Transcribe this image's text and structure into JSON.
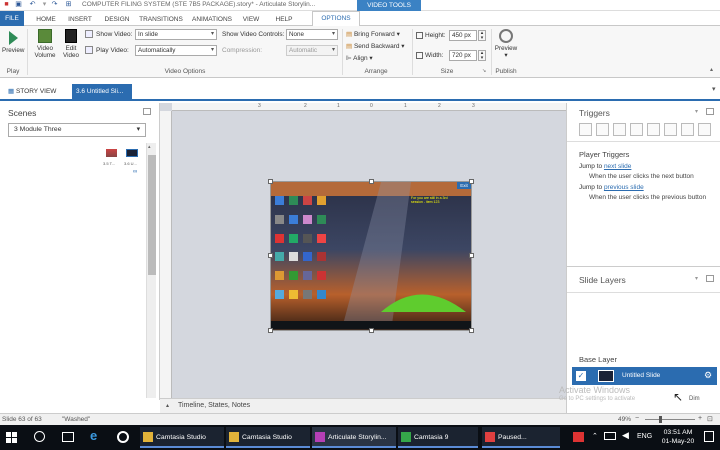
{
  "titlebar": {
    "title": "COMPUTER FILING SYSTEM (STE 7B5 PACKAGE).story* - Articulate Storylin...",
    "context_tab": "VIDEO TOOLS"
  },
  "tabs": [
    "FILE",
    "HOME",
    "INSERT",
    "DESIGN",
    "TRANSITIONS",
    "ANIMATIONS",
    "VIEW",
    "HELP",
    "OPTIONS"
  ],
  "ribbon": {
    "preview": {
      "label": "Preview",
      "group": "Play"
    },
    "video_volume": "Video Volume",
    "edit_video": "Edit Video",
    "show_video": {
      "label": "Show Video:",
      "value": "In slide"
    },
    "play_video": {
      "label": "Play Video:",
      "value": "Automatically"
    },
    "show_controls": {
      "label": "Show Video Controls:",
      "value": "None"
    },
    "compression": {
      "label": "Compression:",
      "value": "Automatic"
    },
    "video_options_group": "Video Options",
    "arrange": {
      "bring_forward": "Bring Forward",
      "send_backward": "Send Backward",
      "align": "Align",
      "group": "Arrange"
    },
    "size": {
      "height_label": "Height:",
      "height": "450 px",
      "width_label": "Width:",
      "width": "720 px",
      "group": "Size"
    },
    "publish": {
      "preview": "Preview",
      "group": "Publish"
    }
  },
  "doctabs": {
    "story": "STORY VIEW",
    "active": "3.6 Untitled Sli..."
  },
  "scenes": {
    "title": "Scenes",
    "selected": "3 Module Three",
    "thumbs": [
      "3.5 T...",
      "3.6 U..."
    ]
  },
  "stage": {
    "ruler": [
      "3",
      "2",
      "1",
      "0",
      "1",
      "2",
      "3"
    ],
    "exit_label": "Exit",
    "note_text": "For you are still in a 3rd\nsession - item 123"
  },
  "timeline": "Timeline, States, Notes",
  "triggers": {
    "title": "Triggers",
    "player_triggers": "Player Triggers",
    "items": [
      {
        "prefix": "Jump to ",
        "link": "next slide",
        "desc": "When the user clicks the next button"
      },
      {
        "prefix": "Jump to ",
        "link": "previous slide",
        "desc": "When the user clicks the previous button"
      }
    ]
  },
  "layers": {
    "title": "Slide Layers",
    "base_title": "Base Layer",
    "base_item": "Untitled Slide",
    "watermark": "Activate Windows",
    "watermark_sub": "Go to PC settings to activate",
    "dim": "Dim"
  },
  "status": {
    "slide": "Slide 63 of 63",
    "theme": "\"Washed\"",
    "zoom": "49%"
  },
  "taskbar": {
    "apps": [
      "Camtasia Studio",
      "Camtasia Studio",
      "Articulate Storylin...",
      "Camtasia 9",
      "Paused..."
    ],
    "lang": "ENG",
    "time": "03:51 AM",
    "date": "01-May-20"
  },
  "colors": {
    "accent": "#2b6cb0",
    "taskbar": "#0a0e14",
    "stage": "#d4d7de"
  }
}
